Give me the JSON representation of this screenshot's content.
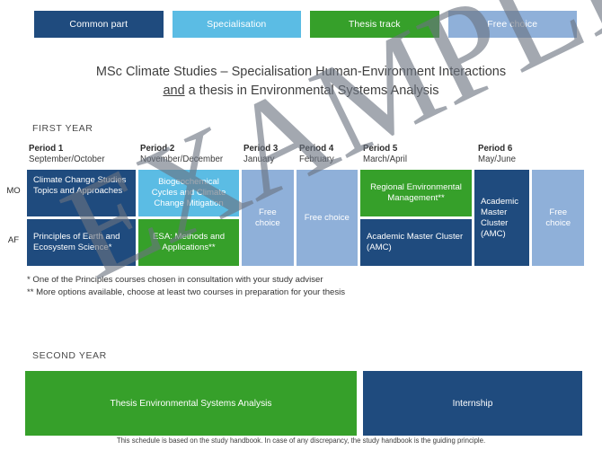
{
  "colors": {
    "common_part": "#1f4b7e",
    "specialisation": "#5bbce4",
    "thesis_track": "#36a02a",
    "free_choice": "#8fb0d9"
  },
  "legend": [
    {
      "label": "Common part",
      "color_key": "common_part"
    },
    {
      "label": "Specialisation",
      "color_key": "specialisation"
    },
    {
      "label": "Thesis track",
      "color_key": "thesis_track"
    },
    {
      "label": "Free choice",
      "color_key": "free_choice"
    }
  ],
  "title": {
    "line1": "MSc Climate Studies – Specialisation Human-Environment Interactions",
    "line2_underlined": "and",
    "line2_rest": " a thesis in Environmental Systems Analysis"
  },
  "first_year": {
    "label": "FIRST YEAR",
    "periods": [
      {
        "name": "Period 1",
        "months": "September/October"
      },
      {
        "name": "Period 2",
        "months": "November/December"
      },
      {
        "name": "Period 3",
        "months": "January"
      },
      {
        "name": "Period 4",
        "months": "February"
      },
      {
        "name": "Period 5",
        "months": "March/April"
      },
      {
        "name": "Period 6",
        "months": "May/June"
      }
    ],
    "row_labels": [
      "MO",
      "AF"
    ],
    "cells": {
      "p1_mo": "Climate Change Studies Topics and Approaches",
      "p1_af": "Principles of Earth and Ecosystem Science*",
      "p2_mo": "Biogeochemical Cycles and Climate Change Mitigation",
      "p2_af": "ESA: Methods and Applications**",
      "p3_full": "Free choice",
      "p4_full": "Free choice",
      "p5_mo": "Regional Environmental Management**",
      "p5_af": "Academic Master Cluster (AMC)",
      "p6_a_full": "Academic Master Cluster (AMC)",
      "p6_b_full": "Free choice"
    },
    "footnotes": [
      "* One of the Principles courses chosen in consultation with your study adviser",
      "** More options available, choose at least two courses in preparation for your thesis"
    ]
  },
  "second_year": {
    "label": "SECOND YEAR",
    "blocks": [
      {
        "label": "Thesis Environmental Systems Analysis",
        "color_key": "thesis_track"
      },
      {
        "label": "Internship",
        "color_key": "common_part"
      }
    ]
  },
  "watermark": {
    "text": "EXAMPLE"
  },
  "footer": {
    "text": "This schedule is based on the study handbook. In case of any discrepancy, the study handbook is the guiding principle."
  }
}
